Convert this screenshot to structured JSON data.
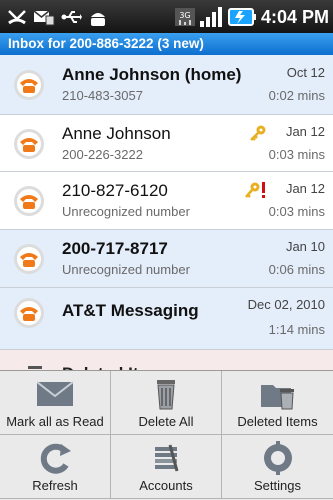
{
  "status_bar": {
    "time": "4:04 PM",
    "left_icons": [
      "missed-call-icon",
      "messages-icon",
      "usb-icon",
      "android-icon"
    ],
    "right_icons": [
      "3g-icon",
      "signal-icon",
      "battery-icon"
    ],
    "network_label": "3G"
  },
  "header": {
    "title": "Inbox for 200-886-3222 (3 new)"
  },
  "messages": [
    {
      "name": "Anne Johnson (home)",
      "subtitle": "210-483-3057",
      "date": "Oct 12",
      "duration": "0:02 mins",
      "unread": true
    },
    {
      "name": "Anne Johnson",
      "subtitle": "200-226-3222",
      "date": "Jan 12",
      "duration": "0:03 mins",
      "unread": false,
      "marker": "key-icon"
    },
    {
      "name": "210-827-6120",
      "subtitle": "Unrecognized number",
      "date": "Jan 12",
      "duration": "0:03 mins",
      "unread": false,
      "marker": "key-urgent-icon"
    },
    {
      "name": "200-717-8717",
      "subtitle": "Unrecognized number",
      "date": "Jan 10",
      "duration": "0:06 mins",
      "unread": true
    },
    {
      "name": "AT&T Messaging",
      "subtitle": "",
      "date": "Dec 02, 2010",
      "duration": "1:14 mins",
      "unread": true
    }
  ],
  "deleted_row": {
    "label": "Deleted Items"
  },
  "menu": [
    {
      "label": "Mark all as Read",
      "icon": "envelope-icon"
    },
    {
      "label": "Delete All",
      "icon": "trash-icon"
    },
    {
      "label": "Deleted Items",
      "icon": "deleted-folder-icon"
    },
    {
      "label": "Refresh",
      "icon": "refresh-icon"
    },
    {
      "label": "Accounts",
      "icon": "accounts-icon"
    },
    {
      "label": "Settings",
      "icon": "settings-icon"
    }
  ],
  "colors": {
    "accent": "#1a80df",
    "unread_bg": "#e4edfa",
    "phone_orange": "#f07a1a"
  }
}
